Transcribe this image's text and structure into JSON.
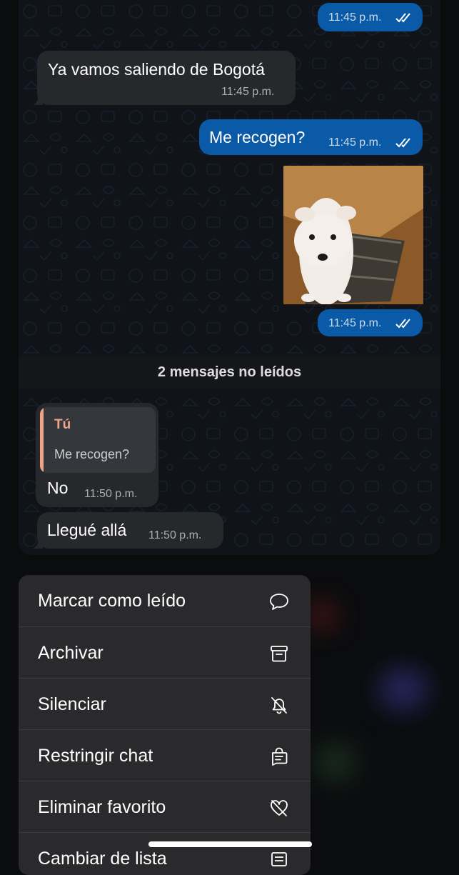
{
  "messages": {
    "m1": {
      "time": "11:45 p.m."
    },
    "m2": {
      "text": "Ya vamos saliendo de Bogotá",
      "time": "11:45 p.m."
    },
    "m3": {
      "text": "Me recogen?",
      "time": "11:45 p.m."
    },
    "m4": {
      "time": "11:45 p.m."
    },
    "m5": {
      "reply_author": "Tú",
      "reply_text": "Me recogen?",
      "text": "No",
      "time": "11:50 p.m."
    },
    "m6": {
      "text": "Llegué allá",
      "time": "11:50 p.m."
    }
  },
  "unread_divider": "2 mensajes no leídos",
  "menu": {
    "items": [
      {
        "label": "Marcar como leído",
        "icon": "chat-bubble-icon"
      },
      {
        "label": "Archivar",
        "icon": "archive-box-icon"
      },
      {
        "label": "Silenciar",
        "icon": "bell-slash-icon"
      },
      {
        "label": "Restringir chat",
        "icon": "lock-chat-icon"
      },
      {
        "label": "Eliminar favorito",
        "icon": "heart-slash-icon"
      },
      {
        "label": "Cambiar de lista",
        "icon": "list-icon"
      }
    ]
  },
  "colors": {
    "outgoing_bubble": "#0a5aa8",
    "incoming_bubble": "#26282b",
    "reply_accent": "#f0a48a",
    "menu_background": "#2a2a2c"
  }
}
